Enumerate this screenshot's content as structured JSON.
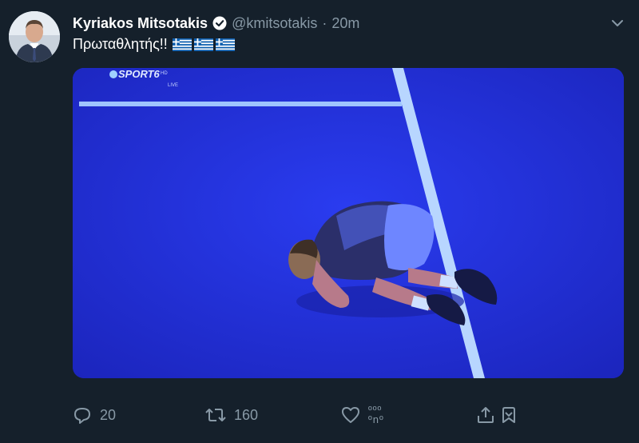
{
  "tweet": {
    "author_name": "Kyriakos Mitsotakis",
    "handle": "@kmitsotakis",
    "separator": "·",
    "time": "20m",
    "text": "Πρωταθλητής!!",
    "flags_icon": "greek-flag-icon"
  },
  "media": {
    "channel_logo": "SPORT6",
    "channel_hd": "HD",
    "channel_live": "LIVE",
    "court_color": "#1f2ed1"
  },
  "actions": {
    "reply_count": "20",
    "retweet_count": "160",
    "like_count_top": "ººº",
    "like_count_bottom": "ºnº"
  },
  "colors": {
    "background": "#15202b",
    "muted": "#8899a6"
  }
}
